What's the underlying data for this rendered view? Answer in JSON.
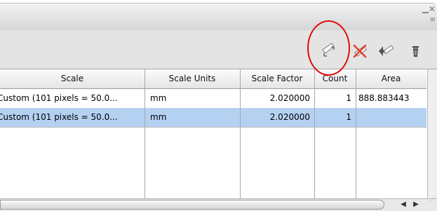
{
  "window": {
    "minimize_icon": "minus-icon",
    "close_icon": "close-x-icon",
    "menu_icon": "panel-menu-icon"
  },
  "toolbar": {
    "icons": [
      "ruler-record-icon",
      "ruler-delete-icon",
      "ruler-export-icon",
      "trash-icon"
    ]
  },
  "table": {
    "columns": [
      "Scale",
      "Scale Units",
      "Scale Factor",
      "Count",
      "Area"
    ],
    "rows": [
      {
        "scale": "Custom (101 pixels = 50.0...",
        "units": "mm",
        "factor": "2.020000",
        "count": "1",
        "area": "888.883443"
      },
      {
        "scale": "Custom (101 pixels = 50.0...",
        "units": "mm",
        "factor": "2.020000",
        "count": "1",
        "area": ""
      }
    ],
    "selected_row": 1
  },
  "colors": {
    "selection": "#b5d1f2",
    "highlight_circle": "#dd0d0d"
  }
}
